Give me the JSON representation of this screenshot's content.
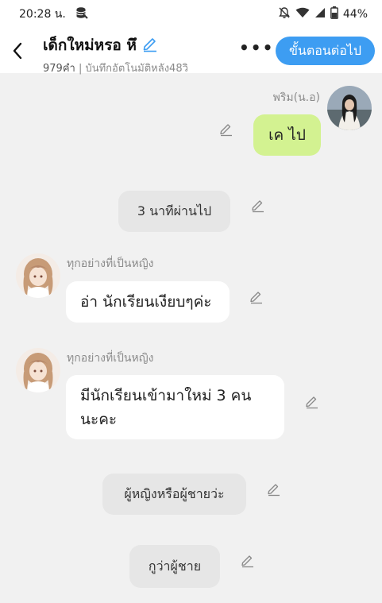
{
  "status_bar": {
    "time": "20:28 น.",
    "battery": "44%"
  },
  "header": {
    "title": "เด็กใหม่หรอ หึ",
    "word_count": "979คำ",
    "autosave": " | บันทึกอัตโนมัติหลัง48วิ",
    "more": "•••",
    "next_button": "ขั้นตอนต่อไป"
  },
  "messages": {
    "m1_sender": "พริม(น.อ)",
    "m1_text": "เค ไป",
    "m2_narration": "3 นาทีผ่านไป",
    "m3_sender": "ทุกอย่างที่เป็นหญิง",
    "m3_text": "อ่า นักเรียนเงียบๆค่ะ",
    "m4_sender": "ทุกอย่างที่เป็นหญิง",
    "m4_text_line1": "มีนักเรียนเข้ามาใหม่ 3 คน",
    "m4_text_line2": "นะคะ",
    "m5_narration": "ผู้หญิงหรือผู้ชายว่ะ",
    "m6_narration": "กูว่าผู้ชาย"
  },
  "colors": {
    "accent": "#3d9df2",
    "my_bubble": "#d3f291",
    "background": "#f1f1f1"
  },
  "icons": [
    "database-icon",
    "bell-off-icon",
    "wifi-icon",
    "signal-icon",
    "battery-icon",
    "back-icon",
    "pencil-icon",
    "avatar"
  ]
}
